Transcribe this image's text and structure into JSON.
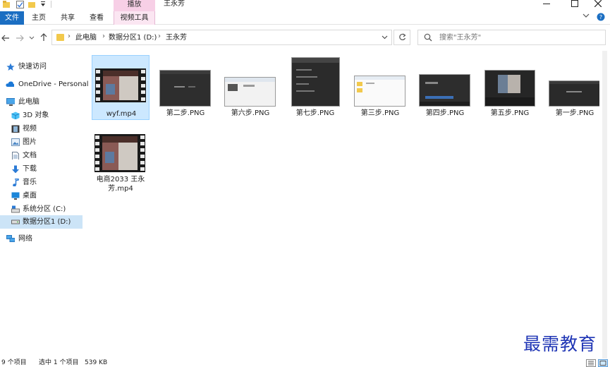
{
  "window": {
    "title": "王永芳",
    "contextual_tab_group": "播放"
  },
  "ribbon": {
    "tabs": [
      "文件",
      "主页",
      "共享",
      "查看",
      "视频工具"
    ]
  },
  "address": {
    "crumbs": [
      "此电脑",
      "数据分区1 (D:)",
      "王永芳"
    ]
  },
  "search": {
    "placeholder": "搜索\"王永芳\""
  },
  "sidebar": {
    "items": [
      {
        "label": "快速访问",
        "icon": "star-icon"
      },
      {
        "label": "OneDrive - Personal",
        "icon": "cloud-icon"
      },
      {
        "label": "此电脑",
        "icon": "computer-icon"
      },
      {
        "label": "3D 对象",
        "icon": "cube-icon"
      },
      {
        "label": "视频",
        "icon": "video-folder-icon"
      },
      {
        "label": "图片",
        "icon": "pictures-folder-icon"
      },
      {
        "label": "文档",
        "icon": "documents-folder-icon"
      },
      {
        "label": "下载",
        "icon": "download-icon"
      },
      {
        "label": "音乐",
        "icon": "music-icon"
      },
      {
        "label": "桌面",
        "icon": "desktop-icon"
      },
      {
        "label": "系统分区 (C:)",
        "icon": "system-drive-icon"
      },
      {
        "label": "数据分区1 (D:)",
        "icon": "drive-icon"
      },
      {
        "label": "网络",
        "icon": "network-icon"
      }
    ]
  },
  "files": [
    {
      "name": "wyf.mp4",
      "kind": "video"
    },
    {
      "name": "第二步.PNG",
      "kind": "image"
    },
    {
      "name": "第六步.PNG",
      "kind": "image"
    },
    {
      "name": "第七步.PNG",
      "kind": "image"
    },
    {
      "name": "第三步.PNG",
      "kind": "image"
    },
    {
      "name": "第四步.PNG",
      "kind": "image"
    },
    {
      "name": "第五步.PNG",
      "kind": "image"
    },
    {
      "name": "第一步.PNG",
      "kind": "image"
    },
    {
      "name": "电商2033 王永芳.mp4",
      "kind": "video"
    }
  ],
  "status": {
    "item_count": "9 个项目",
    "selection": "选中 1 个项目",
    "size": "539 KB"
  },
  "watermark": "最需教育",
  "colors": {
    "accent": "#1b6ec2",
    "selection": "#cce8ff",
    "video_tools_tab": "#f7cfe6"
  }
}
